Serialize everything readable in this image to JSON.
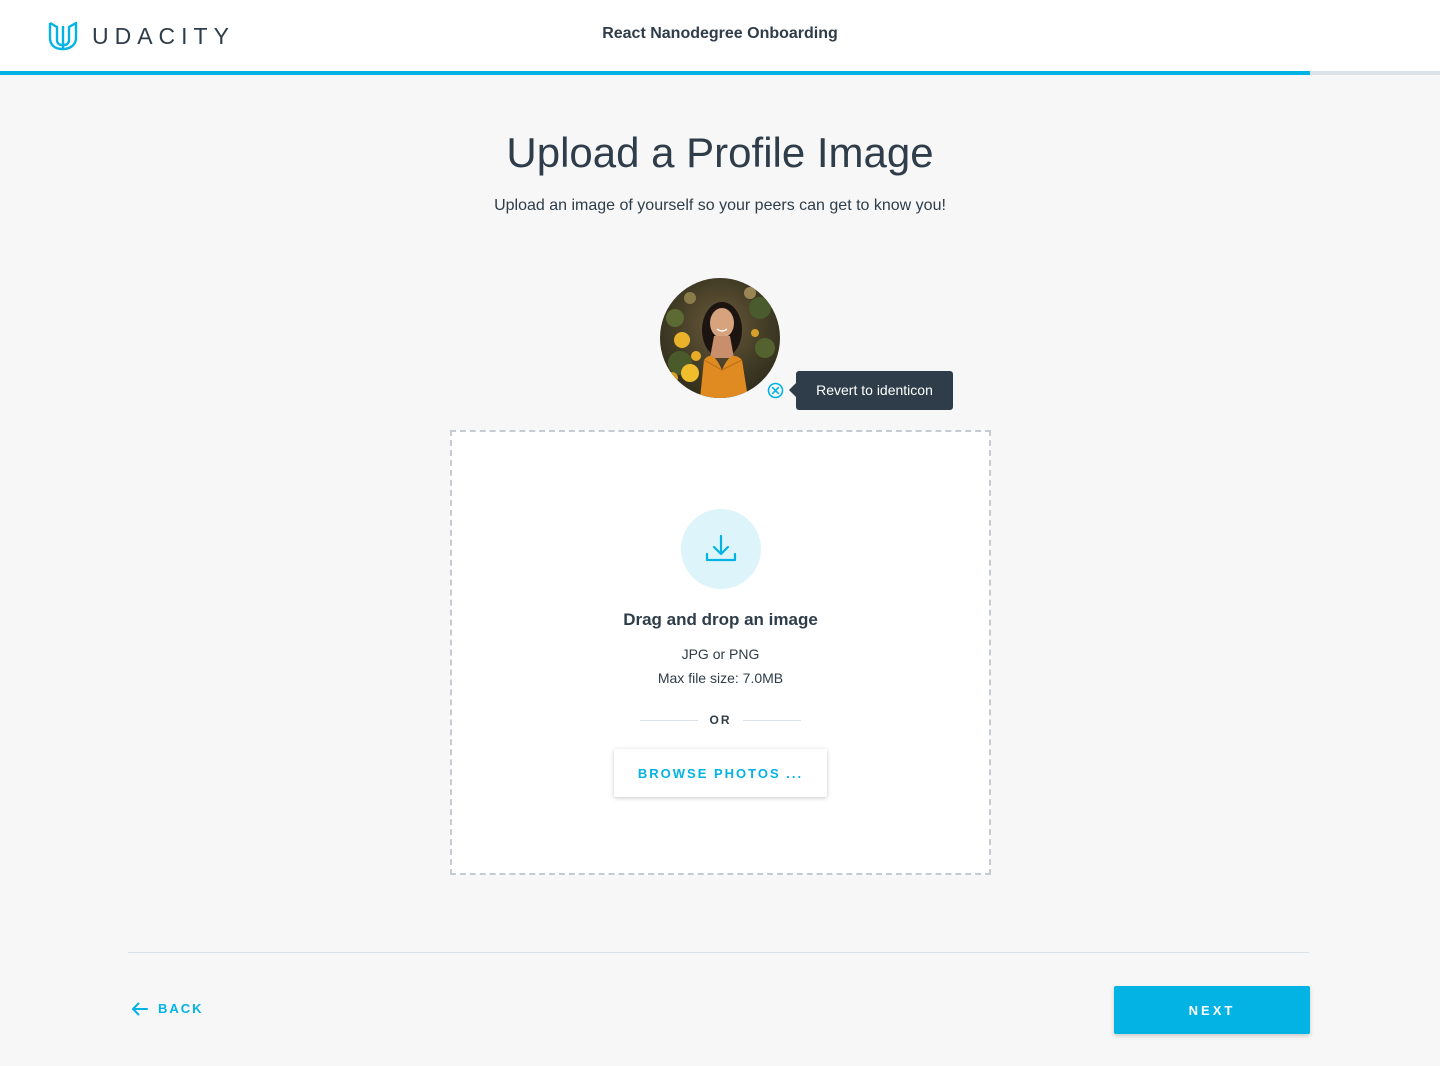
{
  "header": {
    "logo_text": "UDACITY",
    "program_title": "React Nanodegree Onboarding",
    "progress_fraction": 0.91
  },
  "main": {
    "title": "Upload a Profile Image",
    "subtitle": "Upload an image of yourself so your peers can get to know you!",
    "avatar": {
      "icon": "profile-photo",
      "revert_icon": "circle-x-icon",
      "tooltip": "Revert to identicon"
    },
    "dropzone": {
      "icon": "download-icon",
      "title": "Drag and drop an image",
      "formats": "JPG or PNG",
      "max_size": "Max file size: 7.0MB",
      "or_label": "OR",
      "browse_label": "BROWSE PHOTOS ..."
    }
  },
  "footer": {
    "back_icon": "arrow-left-icon",
    "back_label": "BACK",
    "next_label": "NEXT"
  },
  "colors": {
    "accent": "#02b3e4",
    "text": "#2e3d49",
    "background": "#f7f7f7",
    "tooltip_bg": "#2e3d49",
    "upload_circle_bg": "#ddf4fb"
  }
}
